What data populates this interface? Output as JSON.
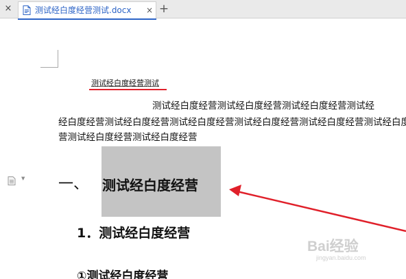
{
  "tabs": {
    "left_close_glyph": "×",
    "active": {
      "title": "测试经白度经营测试.docx",
      "close_glyph": "×"
    },
    "new_tab_glyph": "+"
  },
  "document": {
    "title": "测试经白度经营测试",
    "body_lines": [
      "测试经白度经营测试经白度经营测试经白度经营测试经",
      "经白度经营测试经白度经营测试经白度经营测试经白度经营测试经白度经营测试经白度经",
      "营测试经白度经营测试经白度经营"
    ],
    "heading1": {
      "number": "一、",
      "text": "测试经白度经营"
    },
    "heading2": {
      "text": "1．测试经白度经营"
    },
    "heading3": {
      "text": "①测试经白度经营"
    }
  },
  "watermark": {
    "logo": "Bai经验",
    "url": "jingyan.baidu.com"
  },
  "colors": {
    "accent": "#2b63c6",
    "annotation": "#e0202a",
    "highlight": "#c4c4c4"
  },
  "icons": {
    "file": "doc-file-icon",
    "paragraph": "paragraph-icon"
  }
}
